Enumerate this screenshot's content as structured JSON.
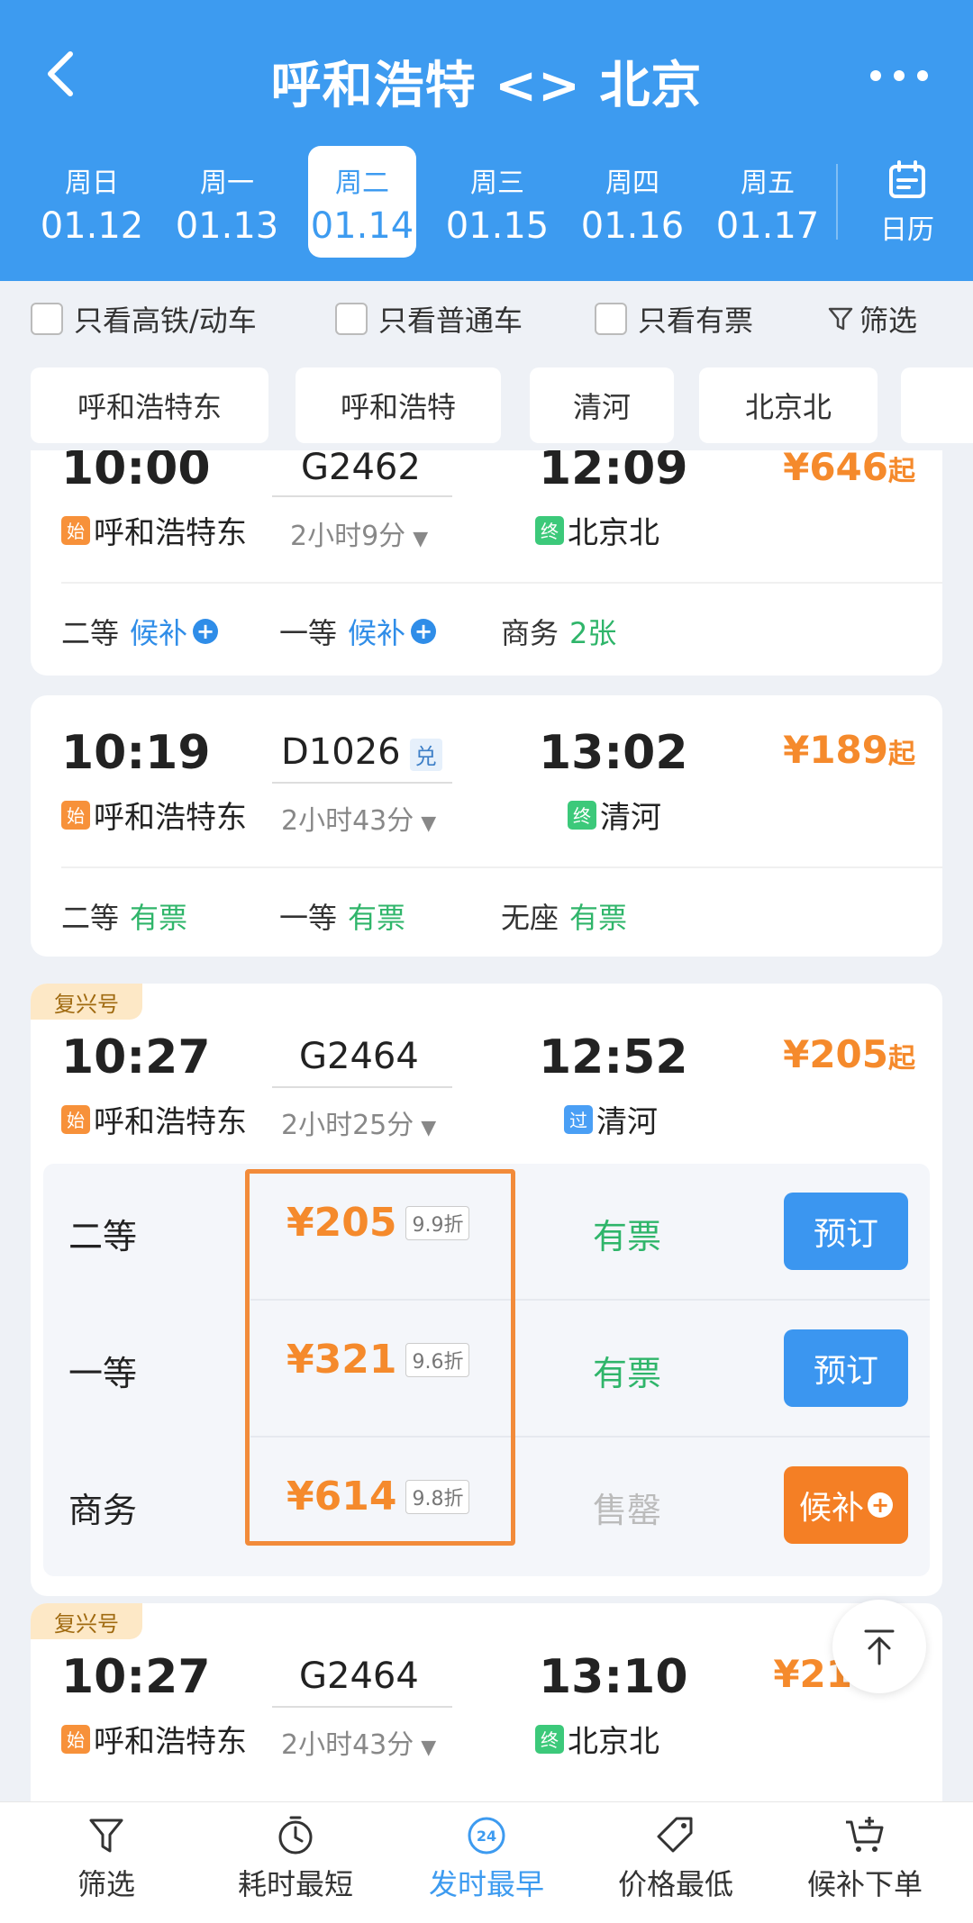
{
  "header": {
    "title": "呼和浩特 <> 北京",
    "dates": [
      {
        "weekday": "周日",
        "date": "01.12"
      },
      {
        "weekday": "周一",
        "date": "01.13"
      },
      {
        "weekday": "周二",
        "date": "01.14",
        "active": true
      },
      {
        "weekday": "周三",
        "date": "01.15"
      },
      {
        "weekday": "周四",
        "date": "01.16"
      },
      {
        "weekday": "周五",
        "date": "01.17"
      }
    ],
    "calendar_label": "日历"
  },
  "filters": {
    "gaotie": "只看高铁/动车",
    "putong": "只看普通车",
    "youpiao": "只看有票",
    "filter": "筛选"
  },
  "stations": [
    "呼和浩特东",
    "呼和浩特",
    "清河",
    "北京北"
  ],
  "trains": [
    {
      "dep_time": "10:00",
      "train_no": "G2462",
      "arr_time": "12:09",
      "from_tag": "始",
      "from": "呼和浩特东",
      "duration": "2小时9分",
      "to_tag": "终",
      "to": "北京北",
      "price": "¥646",
      "price_suffix": "起",
      "seats": [
        {
          "name": "二等",
          "status": "候补"
        },
        {
          "name": "一等",
          "status": "候补"
        },
        {
          "name": "商务",
          "status": "2张"
        }
      ]
    },
    {
      "dep_time": "10:19",
      "train_no": "D1026",
      "train_badge": "兑",
      "arr_time": "13:02",
      "from_tag": "始",
      "from": "呼和浩特东",
      "duration": "2小时43分",
      "to_tag": "终",
      "to": "清河",
      "price": "¥189",
      "price_suffix": "起",
      "seats": [
        {
          "name": "二等",
          "status": "有票"
        },
        {
          "name": "一等",
          "status": "有票"
        },
        {
          "name": "无座",
          "status": "有票"
        }
      ]
    },
    {
      "badge": "复兴号",
      "dep_time": "10:27",
      "train_no": "G2464",
      "arr_time": "12:52",
      "from_tag": "始",
      "from": "呼和浩特东",
      "duration": "2小时25分",
      "to_tag": "过",
      "to": "清河",
      "price": "¥205",
      "price_suffix": "起",
      "seat_panel": [
        {
          "name": "二等",
          "price": "¥205",
          "discount": "9.9折",
          "status": "有票",
          "button": "预订"
        },
        {
          "name": "一等",
          "price": "¥321",
          "discount": "9.6折",
          "status": "有票",
          "button": "预订"
        },
        {
          "name": "商务",
          "price": "¥614",
          "discount": "9.8折",
          "status": "售罄",
          "button": "候补"
        }
      ]
    },
    {
      "badge": "复兴号",
      "dep_time": "10:27",
      "train_no": "G2464",
      "arr_time": "13:10",
      "from_tag": "始",
      "from": "呼和浩特东",
      "duration": "2小时43分",
      "to_tag": "终",
      "to": "北京北",
      "price": "¥21"
    }
  ],
  "bottom_nav": [
    {
      "label": "筛选",
      "icon": "filter-icon"
    },
    {
      "label": "耗时最短",
      "icon": "timer-icon"
    },
    {
      "label": "发时最早",
      "icon": "clock-24-icon",
      "active": true
    },
    {
      "label": "价格最低",
      "icon": "price-tag-icon"
    },
    {
      "label": "候补下单",
      "icon": "cart-plus-icon"
    }
  ],
  "colors": {
    "primary": "#3d9bf0",
    "price": "#f58a2c",
    "available": "#2fb56a",
    "highlight": "#f28b3a"
  }
}
